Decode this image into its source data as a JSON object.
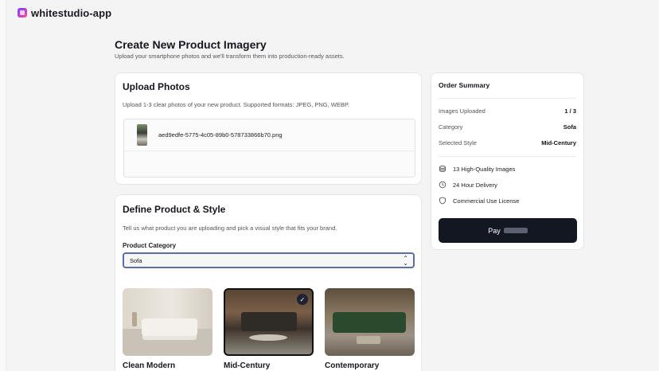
{
  "app": {
    "name": "whitestudio-app"
  },
  "page": {
    "title": "Create New Product Imagery",
    "subtitle": "Upload your smartphone photos and we'll transform them into production-ready assets."
  },
  "upload": {
    "title": "Upload Photos",
    "description": "Upload 1-3 clear photos of your new product. Supported formats: JPEG, PNG, WEBP.",
    "files": [
      {
        "name": "aed9edfe-5775-4c05-89b0-578733866b70.png"
      }
    ]
  },
  "define": {
    "title": "Define Product & Style",
    "description": "Tell us what product you are uploading and pick a visual style that fits your brand.",
    "category_label": "Product Category",
    "category_value": "Sofa",
    "styles": [
      {
        "label": "Clean Modern",
        "selected": false
      },
      {
        "label": "Mid-Century",
        "selected": true
      },
      {
        "label": "Contemporary",
        "selected": false
      }
    ]
  },
  "summary": {
    "title": "Order Summary",
    "rows": [
      {
        "key": "Images Uploaded",
        "value": "1 / 3"
      },
      {
        "key": "Category",
        "value": "Sofa"
      },
      {
        "key": "Selected Style",
        "value": "Mid-Century"
      }
    ],
    "features": [
      {
        "icon": "stack-icon",
        "text": "13 High-Quality Images"
      },
      {
        "icon": "clock-icon",
        "text": "24 Hour Delivery"
      },
      {
        "icon": "shield-icon",
        "text": "Commercial Use License"
      }
    ],
    "pay_label": "Pay"
  }
}
